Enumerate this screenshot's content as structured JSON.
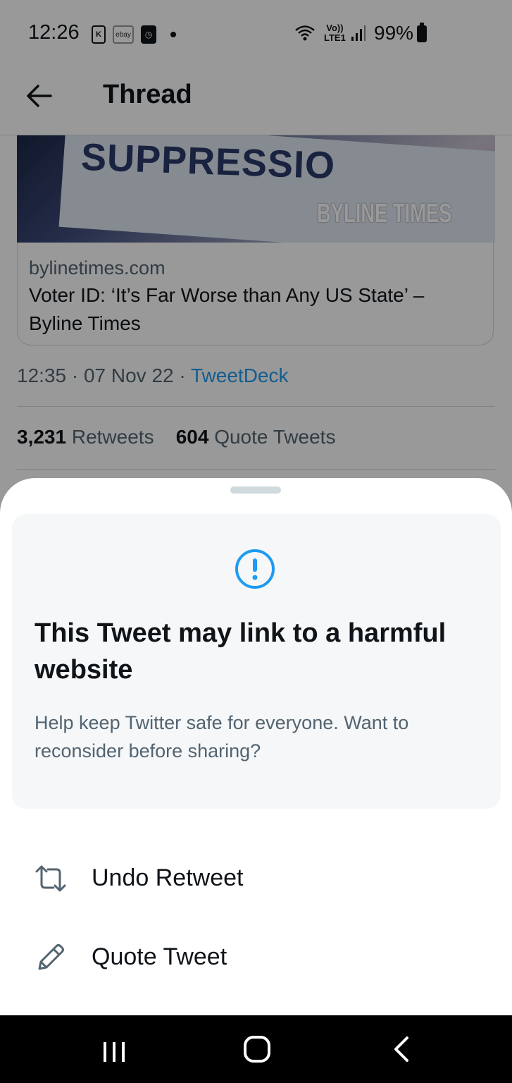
{
  "status_bar": {
    "time": "12:26",
    "notif_icons": [
      "k-app-icon",
      "ebay-icon",
      "clock-icon",
      "dot-icon"
    ],
    "ebay_label": "ebay",
    "k_label": "K",
    "network_label_1": "Vo))",
    "network_label_2": "LTE1",
    "battery": "99%"
  },
  "header": {
    "title": "Thread"
  },
  "link_card": {
    "image_text": "SUPPRESSIO",
    "image_brand": "BYLINE TIMES",
    "domain": "bylinetimes.com",
    "title": "Voter ID: ‘It’s Far Worse than Any US State’ – Byline Times"
  },
  "tweet_meta": {
    "time": "12:35",
    "date": "07 Nov 22",
    "source": "TweetDeck",
    "separator": "·"
  },
  "stats": {
    "retweets_count": "3,231",
    "retweets_label": "Retweets",
    "quotes_count": "604",
    "quotes_label": "Quote Tweets"
  },
  "sheet": {
    "warning_title": "This Tweet may link to a harmful website",
    "warning_desc": "Help keep Twitter safe for everyone. Want to reconsider before sharing?",
    "actions": [
      {
        "label": "Undo Retweet",
        "icon": "retweet-icon"
      },
      {
        "label": "Quote Tweet",
        "icon": "pencil-icon"
      }
    ]
  },
  "colors": {
    "accent": "#1d9bf0",
    "text_primary": "#0f1419",
    "text_secondary": "#536471",
    "warning_bg": "#f5f7f8",
    "alert_icon": "#1d9bf0"
  }
}
